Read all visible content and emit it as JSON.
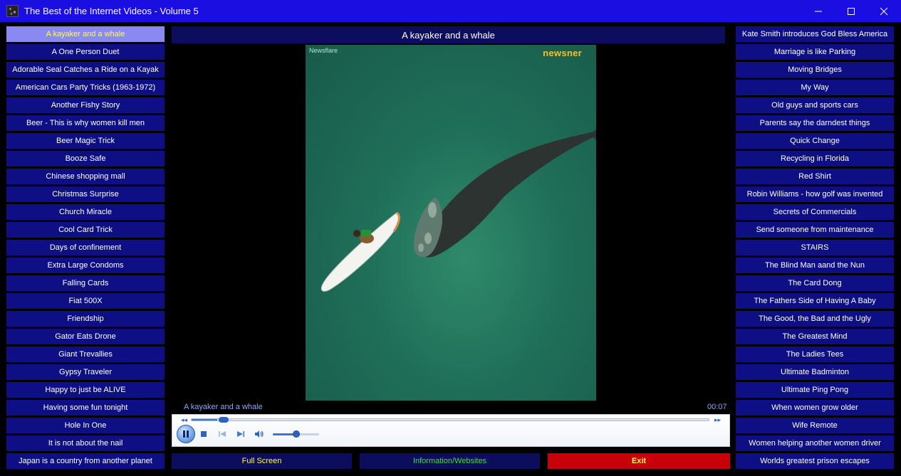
{
  "window": {
    "title": "The Best of the Internet Videos - Volume 5"
  },
  "left_list": [
    "A kayaker and a whale",
    "A One Person Duet",
    "Adorable Seal Catches a Ride on a Kayak",
    "American Cars Party Tricks (1963-1972)",
    "Another Fishy Story",
    "Beer - This is why women kill men",
    "Beer Magic Trick",
    "Booze Safe",
    "Chinese shopping mall",
    "Christmas Surprise",
    "Church Miracle",
    "Cool Card Trick",
    "Days of confinement",
    "Extra Large Condoms",
    "Falling Cards",
    "Fiat 500X",
    "Friendship",
    "Gator Eats Drone",
    "Giant Trevallies",
    "Gypsy Traveler",
    "Happy to just be ALIVE",
    "Having some fun tonight",
    "Hole In One",
    "It is not about the nail",
    "Japan is a country from another planet"
  ],
  "right_list": [
    "Kate Smith introduces God Bless America",
    "Marriage is like Parking",
    "Moving Bridges",
    "My Way",
    "Old guys and sports cars",
    "Parents say the darndest things",
    "Quick Change",
    "Recycling in Florida",
    "Red Shirt",
    "Robin Williams -  how golf was invented",
    "Secrets of Commercials",
    "Send someone from maintenance",
    "STAIRS",
    "The Blind Man aand the Nun",
    "The Card Dong",
    "The Fathers Side of Having A Baby",
    "The Good, the Bad and the Ugly",
    "The Greatest Mind",
    "The Ladies Tees",
    "Ultimate Badminton",
    "Ultimate Ping Pong",
    "When women grow older",
    "Wife Remote",
    "Women helping another women driver",
    "Worlds greatest prison escapes"
  ],
  "selected_index": 0,
  "video": {
    "title": "A kayaker and a whale",
    "watermark_left": "Newsflare",
    "watermark_right": "newsner"
  },
  "player": {
    "now_playing": "A kayaker and a whale",
    "time": "00:07",
    "progress_fraction": 0.05,
    "volume_fraction": 0.5,
    "state": "playing",
    "icons": [
      "pause-icon",
      "stop-icon",
      "previous-icon",
      "next-icon",
      "speaker-icon"
    ]
  },
  "buttons": {
    "fullscreen": "Full Screen",
    "info": "Information/Websites",
    "exit": "Exit"
  },
  "colors": {
    "frame": "#1a0ee0",
    "list_item": "#0e0f84",
    "selected_item": "#8a88f2",
    "selected_text": "#ffff44",
    "exit_button": "#c8000a"
  }
}
